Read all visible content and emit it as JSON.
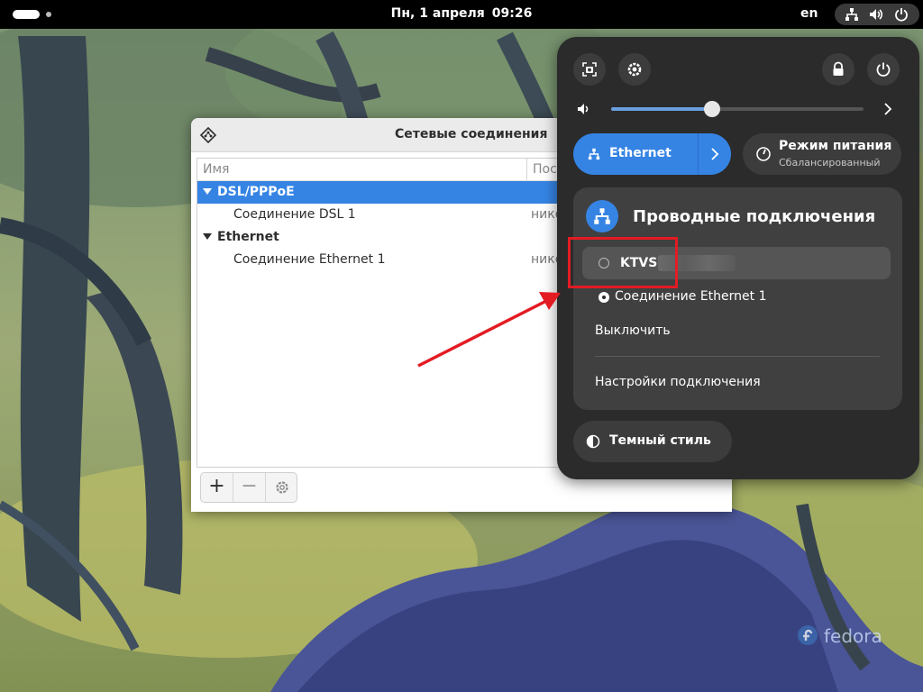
{
  "topbar": {
    "date": "Пн, 1 апреля",
    "time": "09:26",
    "language": "en",
    "tray_icons": [
      "network-wired-icon",
      "volume-icon",
      "power-icon"
    ]
  },
  "nm_window": {
    "title": "Сетевые соединения",
    "columns": [
      "Имя",
      "Пос"
    ],
    "groups": [
      {
        "name": "DSL/PPPoE",
        "selected": true,
        "items": [
          {
            "name": "Соединение DSL 1",
            "last_used": "нико"
          }
        ]
      },
      {
        "name": "Ethernet",
        "selected": false,
        "items": [
          {
            "name": "Соединение Ethernet 1",
            "last_used": "нико"
          }
        ]
      }
    ],
    "toolbar": {
      "add": "+",
      "remove": "−"
    }
  },
  "quick_settings": {
    "volume_level": 0.4,
    "ethernet_toggle": {
      "label": "Ethernet",
      "active": true
    },
    "power_mode": {
      "label": "Режим питания",
      "sub": "Сбалансированный"
    },
    "wired_menu": {
      "title": "Проводные подключения",
      "connections": [
        {
          "name": "KTVS",
          "selected": false
        },
        {
          "name": "Соединение Ethernet 1",
          "selected": true
        }
      ],
      "turn_off": "Выключить",
      "settings": "Настройки подключения"
    },
    "dark_style": {
      "label": "Темный стиль"
    }
  },
  "branding": {
    "logo": "fedora"
  },
  "colors": {
    "accent": "#3584e4",
    "annotation": "#e31b23",
    "panel_bg": "#2b2b2b"
  }
}
